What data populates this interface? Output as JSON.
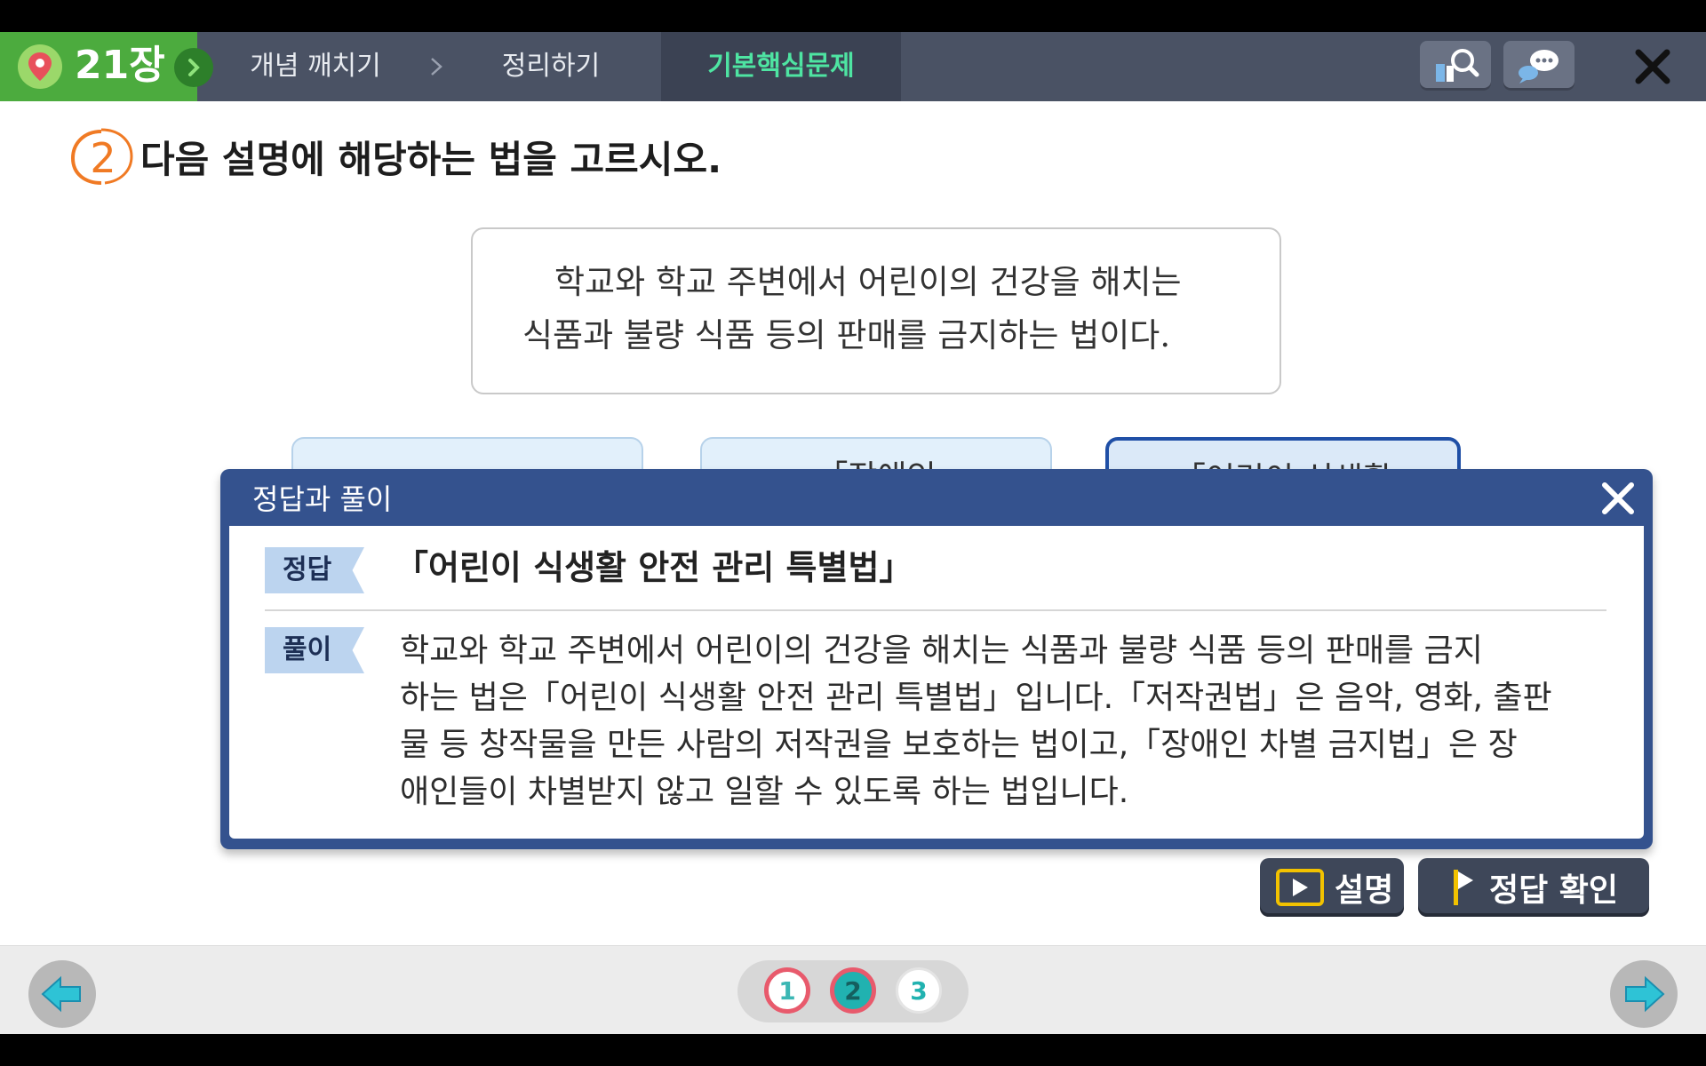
{
  "colors": {
    "topbar": "#4a5264",
    "chapter_green": "#4cab3e",
    "active_tab_text": "#4ee4a2",
    "modal_blue": "#34528e",
    "tag_bg": "#bcd4ef",
    "choice_bg": "#e2f0fb",
    "selected_border": "#1f4fa6",
    "accent_yellow": "#f2c200",
    "page_ring": "#e85a6c",
    "page_fill": "#21b2b0",
    "nav_arrow": "#2ec3d6"
  },
  "header": {
    "chapter": "21장",
    "tabs": [
      {
        "label": "개념 깨치기"
      },
      {
        "label": "정리하기"
      },
      {
        "label": "기본핵심문제",
        "active": true
      }
    ],
    "icons": [
      "map-pin-icon",
      "chevron-right-icon",
      "search-book-icon",
      "chat-icon",
      "close-icon"
    ]
  },
  "question": {
    "number": "2",
    "title": "다음 설명에 해당하는 법을 고르시오.",
    "description": [
      "학교와 학교 주변에서 어린이의 건강을 해치는",
      "식품과 불량 식품 등의 판매를 금지하는 법이다."
    ],
    "choices": [
      {
        "label": ""
      },
      {
        "label": "「장애인"
      },
      {
        "label": "「어린이 식생활",
        "selected": true
      }
    ]
  },
  "modal": {
    "title": "정답과 풀이",
    "answer_tag": "정답",
    "answer": "「어린이 식생활 안전 관리 특별법」",
    "explain_tag": "풀이",
    "explanation": [
      "학교와 학교 주변에서 어린이의 건강을 해치는 식품과 불량 식품 등의 판매를 금지",
      "하는 법은「어린이 식생활 안전 관리 특별법」입니다.「저작권법」은 음악, 영화, 출판",
      "물 등 창작물을 만든 사람의 저작권을 보호하는 법이고,「장애인 차별 금지법」은 장",
      "애인들이 차별받지 않고 일할 수 있도록 하는 법입니다."
    ]
  },
  "actions": {
    "explain_label": "설명",
    "check_label": "정답 확인"
  },
  "pager": {
    "pages": [
      "1",
      "2",
      "3"
    ],
    "current": "2"
  }
}
